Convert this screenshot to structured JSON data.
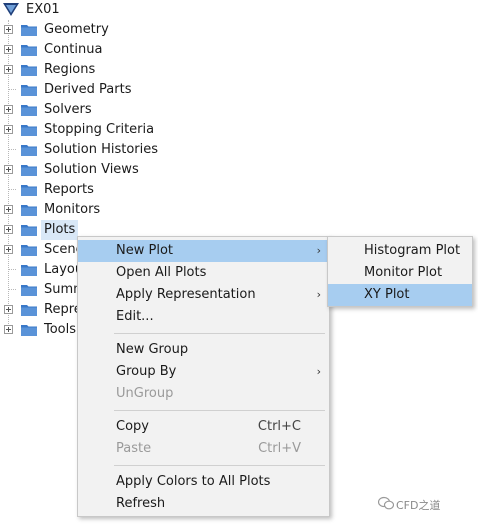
{
  "tree": {
    "root_label": "EX01",
    "items": [
      {
        "label": "Geometry",
        "expandable": true
      },
      {
        "label": "Continua",
        "expandable": true
      },
      {
        "label": "Regions",
        "expandable": true
      },
      {
        "label": "Derived Parts",
        "expandable": false
      },
      {
        "label": "Solvers",
        "expandable": true
      },
      {
        "label": "Stopping Criteria",
        "expandable": true
      },
      {
        "label": "Solution Histories",
        "expandable": false
      },
      {
        "label": "Solution Views",
        "expandable": true
      },
      {
        "label": "Reports",
        "expandable": false
      },
      {
        "label": "Monitors",
        "expandable": true
      },
      {
        "label": "Plots",
        "expandable": true,
        "selected": true
      },
      {
        "label": "Scenes",
        "expandable": true
      },
      {
        "label": "Layouts",
        "expandable": false
      },
      {
        "label": "Summaries",
        "expandable": false
      },
      {
        "label": "Representations",
        "expandable": true
      },
      {
        "label": "Tools",
        "expandable": true
      }
    ]
  },
  "context_menu": {
    "items": [
      {
        "label": "New Plot",
        "has_submenu": true,
        "selected": true
      },
      {
        "label": "Open All Plots"
      },
      {
        "label": "Apply Representation",
        "has_submenu": true
      },
      {
        "label": "Edit..."
      },
      {
        "label": "New Group"
      },
      {
        "label": "Group By",
        "has_submenu": true
      },
      {
        "label": "UnGroup",
        "disabled": true
      },
      {
        "label": "Copy",
        "shortcut": "Ctrl+C"
      },
      {
        "label": "Paste",
        "shortcut": "Ctrl+V",
        "disabled": true
      },
      {
        "label": "Apply Colors to All Plots"
      },
      {
        "label": "Refresh"
      }
    ],
    "arrow_glyph": "›"
  },
  "submenu": {
    "items": [
      {
        "label": "Histogram Plot"
      },
      {
        "label": "Monitor Plot"
      },
      {
        "label": "XY Plot",
        "selected": true
      }
    ]
  },
  "watermark": {
    "text": "CFD之道"
  },
  "colors": {
    "folder_blue": "#3a78c8",
    "selection": "#a7cdf0",
    "tree_highlight": "#d9e8f7",
    "menu_bg": "#f2f2f2"
  }
}
